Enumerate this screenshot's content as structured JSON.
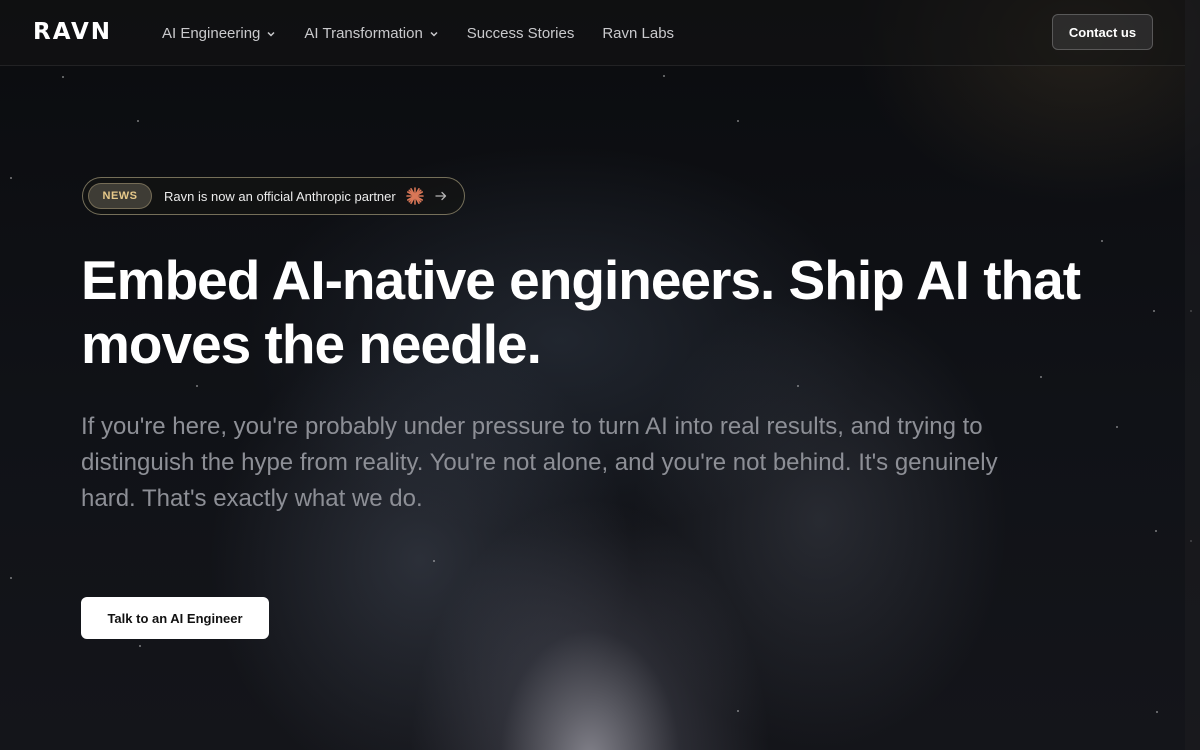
{
  "brand": {
    "logo_text": "RAVN"
  },
  "nav": {
    "items": [
      {
        "label": "AI Engineering",
        "has_dropdown": true
      },
      {
        "label": "AI Transformation",
        "has_dropdown": true
      },
      {
        "label": "Success Stories",
        "has_dropdown": false
      },
      {
        "label": "Ravn Labs",
        "has_dropdown": false
      }
    ],
    "contact_label": "Contact us"
  },
  "news": {
    "badge": "NEWS",
    "text": "Ravn is now an official Anthropic partner",
    "burst_icon": "anthropic-burst-icon",
    "arrow_icon": "arrow-right-icon",
    "burst_color": "#d97757"
  },
  "hero": {
    "headline": "Embed AI-native engineers. Ship AI that moves the needle.",
    "subtext": "If you're here, you're probably under pressure to turn AI into real results, and trying to distinguish the hype from reality. You're not alone, and you're not behind. It's genuinely hard. That's exactly what we do.",
    "cta_label": "Talk to an AI Engineer"
  },
  "colors": {
    "background": "#0c0d10",
    "text": "#ffffff",
    "muted": "#8d8f96",
    "news_badge": "#e6c98a"
  }
}
